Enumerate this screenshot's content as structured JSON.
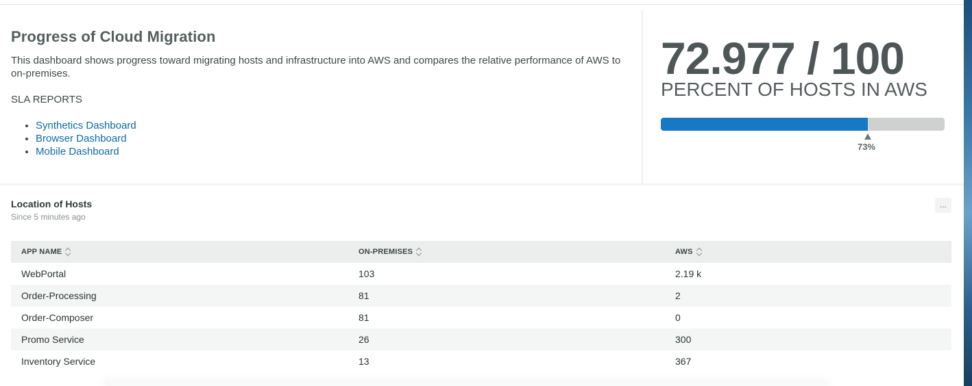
{
  "markdown_widget": {
    "title": "Progress of Cloud Migration",
    "description": "This dashboard shows progress toward migrating hosts and infrastructure into AWS and compares the relative performance of AWS to on-premises.",
    "sla_heading": "SLA REPORTS",
    "links": [
      {
        "label": "Synthetics Dashboard"
      },
      {
        "label": "Browser Dashboard"
      },
      {
        "label": "Mobile Dashboard"
      }
    ]
  },
  "billboard": {
    "value": "72.977 / 100",
    "label": "PERCENT OF HOSTS IN AWS",
    "progress_fraction": 0.73,
    "progress_label": "73%",
    "fill_color": "#1778c4",
    "track_color": "#cfd1d1"
  },
  "table_widget": {
    "title": "Location of Hosts",
    "subtitle": "Since 5 minutes ago",
    "menu_label": "...",
    "columns": [
      "APP NAME",
      "ON-PREMISES",
      "AWS"
    ],
    "rows": [
      [
        "WebPortal",
        "103",
        "2.19 k"
      ],
      [
        "Order-Processing",
        "81",
        "2"
      ],
      [
        "Order-Composer",
        "81",
        "0"
      ],
      [
        "Promo Service",
        "26",
        "300"
      ],
      [
        "Inventory Service",
        "13",
        "367"
      ]
    ]
  }
}
